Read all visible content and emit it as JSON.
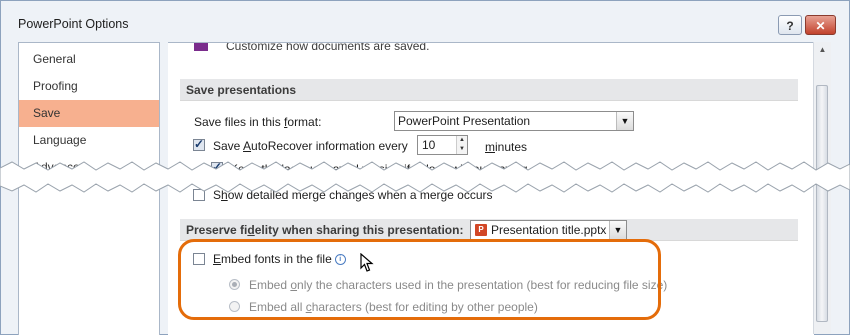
{
  "window": {
    "title": "PowerPoint Options",
    "help_glyph": "?",
    "close_glyph": "✕"
  },
  "sidebar": {
    "items": [
      {
        "label": "General",
        "selected": false
      },
      {
        "label": "Proofing",
        "selected": false
      },
      {
        "label": "Save",
        "selected": true
      },
      {
        "label": "Language",
        "selected": false
      },
      {
        "label": "Advanced",
        "selected": false
      }
    ]
  },
  "content": {
    "top_partial_text": "Customize how documents are saved.",
    "save_section": {
      "header": "Save presentations",
      "format_label_pre": "Save files in this ",
      "format_label_u": "f",
      "format_label_post": "ormat:",
      "format_value": "PowerPoint Presentation",
      "autorecover_pre": "Save ",
      "autorecover_u": "A",
      "autorecover_post": "utoRecover information every",
      "autorecover_checked": true,
      "autorecover_minutes": "10",
      "minutes_u": "m",
      "minutes_rest": "inutes",
      "keep_version_label": "Keep the last autosaved version if I close without saving",
      "keep_version_checked": true,
      "merge_pre": "S",
      "merge_u": "h",
      "merge_post": "ow detailed merge changes when a merge occurs",
      "merge_checked": false
    },
    "fidelity_section": {
      "header_pre": "Preserve fi",
      "header_u": "d",
      "header_post": "elity when sharing this presentation:",
      "file_value": "Presentation title.pptx",
      "embed_u": "E",
      "embed_rest": "mbed fonts in the file",
      "embed_checked": false,
      "info_glyph": "i",
      "option1_pre": "Embed ",
      "option1_u": "o",
      "option1_post": "nly the characters used in the presentation (best for reducing file size)",
      "option1_selected": true,
      "option2_pre": "Embed all ",
      "option2_u": "c",
      "option2_post": "haracters (best for editing by other people)",
      "option2_selected": false
    }
  },
  "colors": {
    "highlight": "#e46c0a",
    "selected_nav": "#f7b08f",
    "section_header_bg": "#e6e7e9"
  }
}
